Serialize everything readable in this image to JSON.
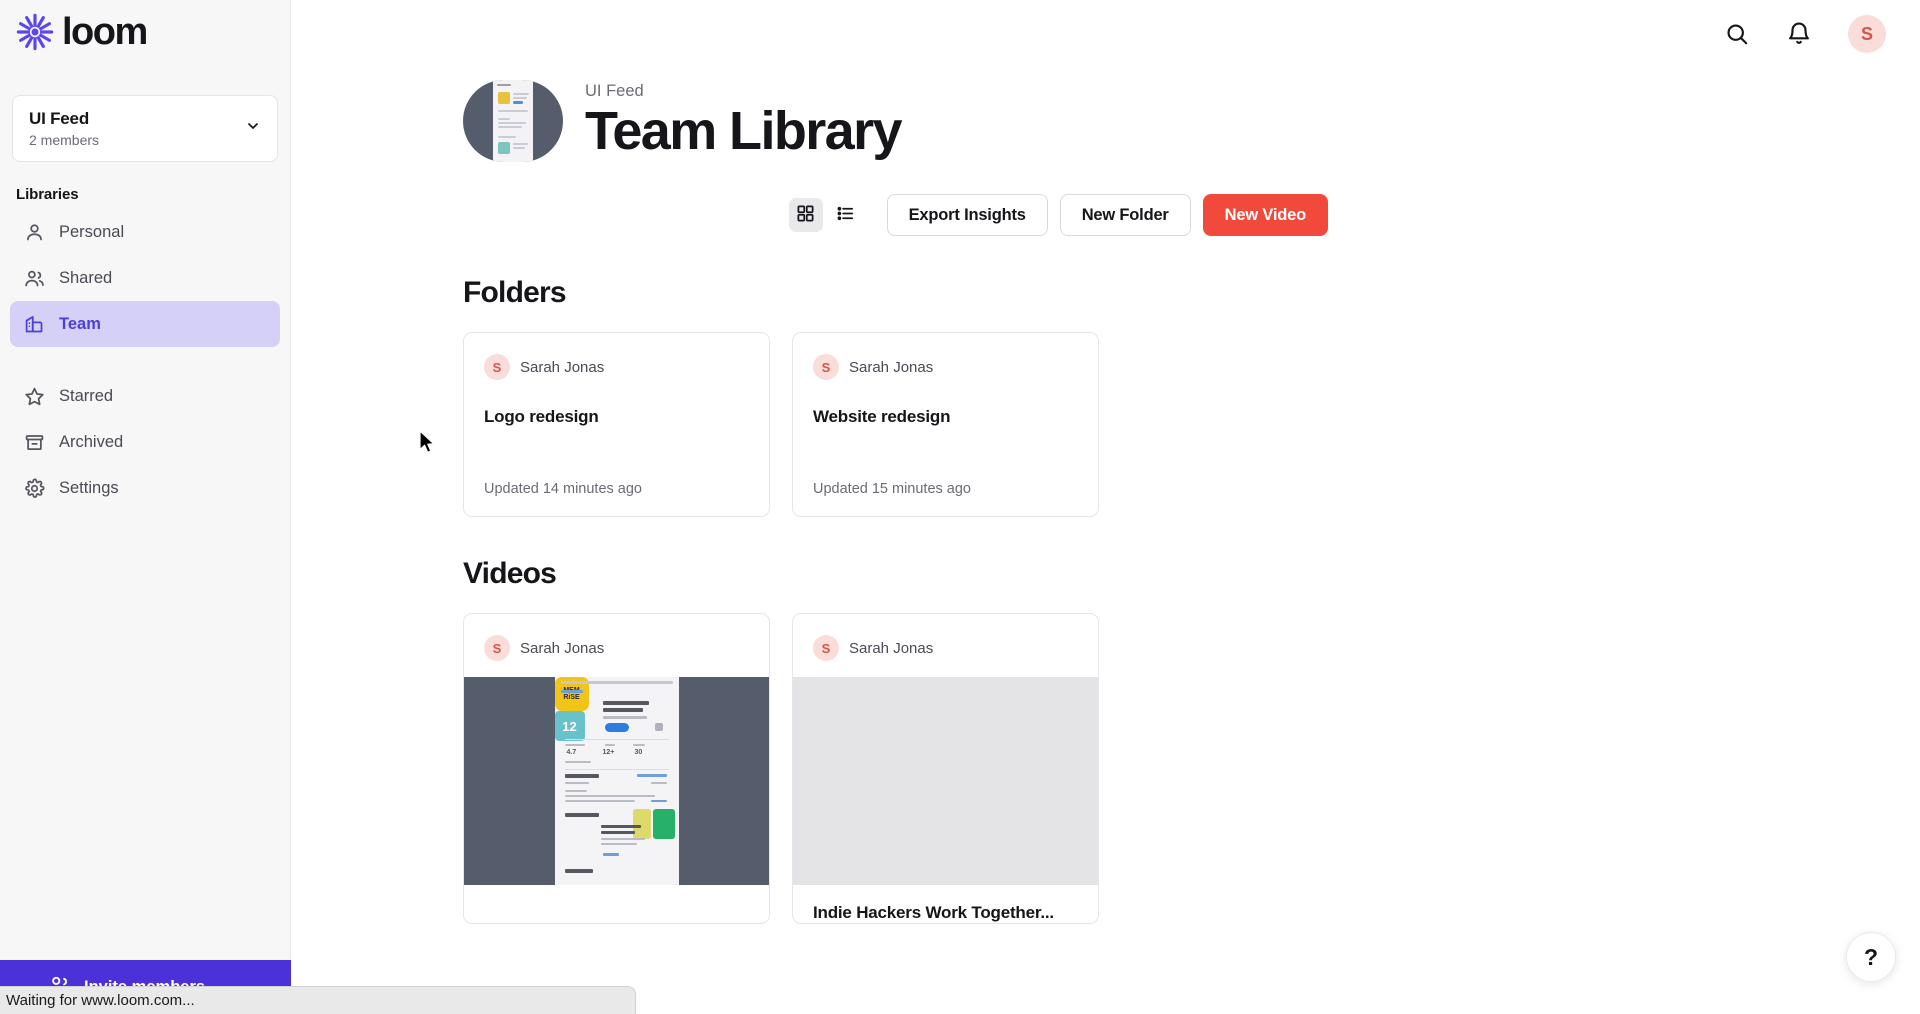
{
  "brand": {
    "name": "loom",
    "logo_icon": "loom-starburst-icon",
    "accent_purple": "#4b32d8",
    "accent_red": "#f2493d",
    "active_nav_bg": "#d5d0f7"
  },
  "sidebar": {
    "workspace": {
      "name": "UI Feed",
      "members": "2 members",
      "chevron_icon": "chevron-down-icon"
    },
    "section_label": "Libraries",
    "items": [
      {
        "label": "Personal",
        "icon": "person-icon",
        "active": false
      },
      {
        "label": "Shared",
        "icon": "people-icon",
        "active": false
      },
      {
        "label": "Team",
        "icon": "building-icon",
        "active": true
      },
      {
        "label": "Starred",
        "icon": "star-icon",
        "active": false
      },
      {
        "label": "Archived",
        "icon": "archive-box-icon",
        "active": false
      },
      {
        "label": "Settings",
        "icon": "gear-icon",
        "active": false
      }
    ],
    "invite": {
      "label": "Invite members",
      "icon": "people-add-icon"
    }
  },
  "topbar": {
    "search_icon": "search-icon",
    "notifications_icon": "bell-icon",
    "avatar_initial": "S"
  },
  "header": {
    "eyebrow": "UI Feed",
    "title": "Team Library",
    "thumb_icon": "workspace-thumbnail"
  },
  "toolbar": {
    "grid_view_icon": "grid-view-icon",
    "list_view_icon": "list-view-icon",
    "grid_view_active": true,
    "export_insights_label": "Export Insights",
    "new_folder_label": "New Folder",
    "new_video_label": "New Video"
  },
  "folders": {
    "title": "Folders",
    "items": [
      {
        "owner": "Sarah Jonas",
        "owner_initial": "S",
        "name": "Logo redesign",
        "updated": "Updated 14 minutes ago"
      },
      {
        "owner": "Sarah Jonas",
        "owner_initial": "S",
        "name": "Website redesign",
        "updated": "Updated 15 minutes ago"
      }
    ]
  },
  "videos": {
    "title": "Videos",
    "items": [
      {
        "owner": "Sarah Jonas",
        "owner_initial": "S",
        "thumbnail": "memrise-app-store-screenshot",
        "thumb_app_name": "MEM RiSE",
        "thumb_rating": "4.7",
        "thumb_age": "12+",
        "thumb_rank": "30",
        "thumb_sub_badge": "12",
        "title": ""
      },
      {
        "owner": "Sarah Jonas",
        "owner_initial": "S",
        "thumbnail": "blank-placeholder",
        "title": "Indie Hackers Work Together..."
      }
    ]
  },
  "help": {
    "label": "?",
    "icon": "question-mark-icon"
  },
  "browser_status": "Waiting for www.loom.com..."
}
